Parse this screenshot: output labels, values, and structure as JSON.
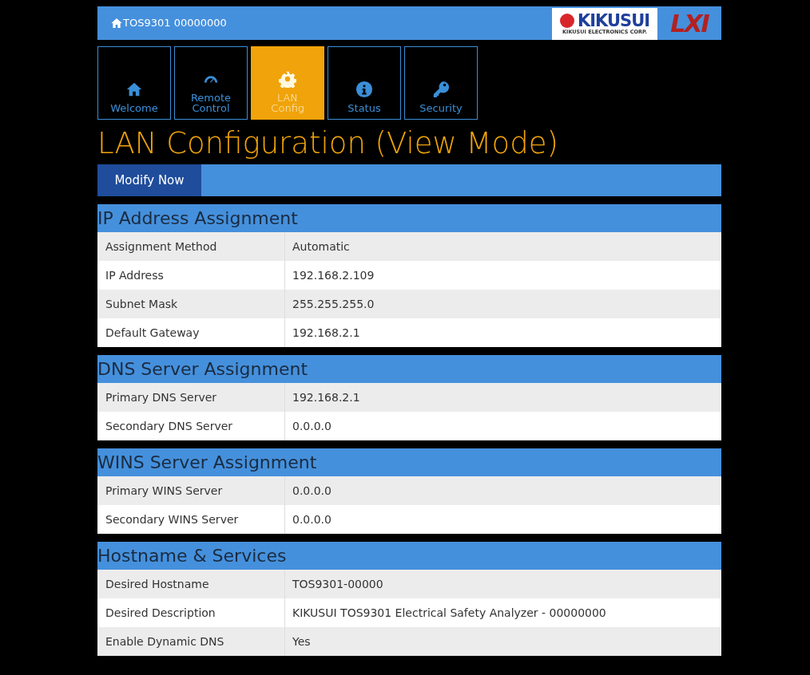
{
  "header": {
    "title": "TOS9301 00000000",
    "logo": {
      "brand": "KIKUSUI",
      "subtitle": "KIKUSUI ELECTRONICS CORP.",
      "lxi": "LXI"
    }
  },
  "tabs": [
    {
      "label": "Welcome",
      "selected": false
    },
    {
      "label": "Remote Control",
      "selected": false
    },
    {
      "label": "LAN Config",
      "selected": true
    },
    {
      "label": "Status",
      "selected": false
    },
    {
      "label": "Security",
      "selected": false
    }
  ],
  "page_title": "LAN Configuration (View Mode)",
  "toolbar": {
    "button": "Modify Now"
  },
  "sections": [
    {
      "title": "IP Address Assignment",
      "rows": [
        [
          "Assignment Method",
          "Automatic"
        ],
        [
          "IP Address",
          "192.168.2.109"
        ],
        [
          "Subnet Mask",
          "255.255.255.0"
        ],
        [
          "Default Gateway",
          "192.168.2.1"
        ]
      ]
    },
    {
      "title": "DNS Server Assignment",
      "rows": [
        [
          "Primary DNS Server",
          "192.168.2.1"
        ],
        [
          "Secondary DNS Server",
          "0.0.0.0"
        ]
      ]
    },
    {
      "title": "WINS Server Assignment",
      "rows": [
        [
          "Primary WINS Server",
          "0.0.0.0"
        ],
        [
          "Secondary WINS Server",
          "0.0.0.0"
        ]
      ]
    },
    {
      "title": "Hostname & Services",
      "rows": [
        [
          "Desired Hostname",
          "TOS9301-00000"
        ],
        [
          "Desired Description",
          "KIKUSUI TOS9301 Electrical Safety Analyzer - 00000000"
        ],
        [
          "Enable Dynamic DNS",
          "Yes"
        ]
      ]
    }
  ]
}
